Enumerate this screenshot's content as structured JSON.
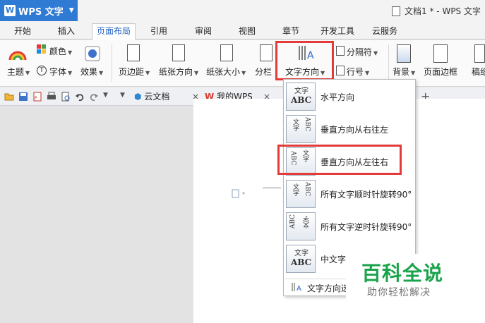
{
  "app": {
    "name": "WPS 文字",
    "logo": "W",
    "doc_title": "文档1 * - WPS 文字"
  },
  "tabs": [
    "开始",
    "插入",
    "页面布局",
    "引用",
    "审阅",
    "视图",
    "章节",
    "开发工具",
    "云服务"
  ],
  "active_tab": "页面布局",
  "ribbon": {
    "theme": "主题",
    "color": "颜色",
    "font": "字体",
    "effect": "效果",
    "margin": "页边距",
    "orientation": "纸张方向",
    "size": "纸张大小",
    "columns": "分栏",
    "text_direction": "文字方向",
    "separator": "分隔符",
    "line_number": "行号",
    "background": "背景",
    "page_border": "页面边框",
    "draft": "稿纸"
  },
  "doc_tabs": {
    "cloud": "云文档",
    "mywps": "我的WPS",
    "add": "+"
  },
  "text_direction_menu": {
    "items": [
      {
        "label": "水平方向",
        "icon_top": "文字",
        "icon_bottom": "ABC"
      },
      {
        "label": "垂直方向从右往左",
        "icon_top": "ABC",
        "icon_bottom": "文字"
      },
      {
        "label": "垂直方向从左往右",
        "icon_top": "文字",
        "icon_bottom": "ABC"
      },
      {
        "label": "所有文字顺时针旋转90°",
        "icon_top": "ABC",
        "icon_bottom": "文字"
      },
      {
        "label": "所有文字逆时针旋转90°",
        "icon_top": "ABC",
        "icon_bottom": "文字"
      },
      {
        "label": "中文字",
        "icon_top": "文字",
        "icon_bottom": "ABC"
      }
    ],
    "options": "文字方向选"
  },
  "watermark": {
    "title": "百科全说",
    "subtitle": "助你轻松解决"
  },
  "colors": {
    "accent": "#2f7ad3",
    "highlight": "#e33a3a",
    "watermark_green": "#1aa34a"
  }
}
